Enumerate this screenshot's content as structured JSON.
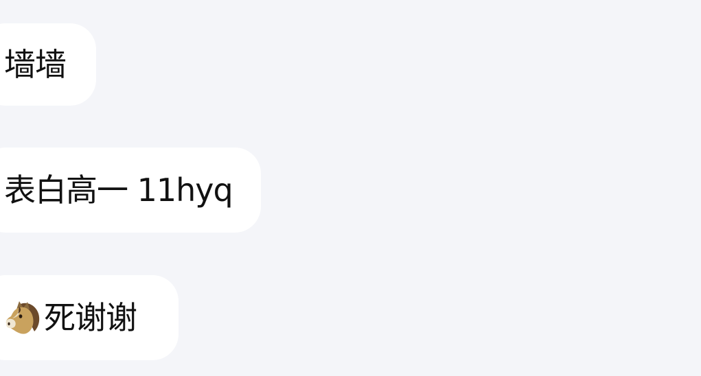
{
  "messages": [
    {
      "text": "墙墙"
    },
    {
      "text": "表白高一 11hyq"
    },
    {
      "emoji": "horse-face-icon",
      "text": "死谢谢"
    }
  ],
  "colors": {
    "background": "#f4f5f9",
    "bubble": "#ffffff",
    "text": "#111111"
  }
}
